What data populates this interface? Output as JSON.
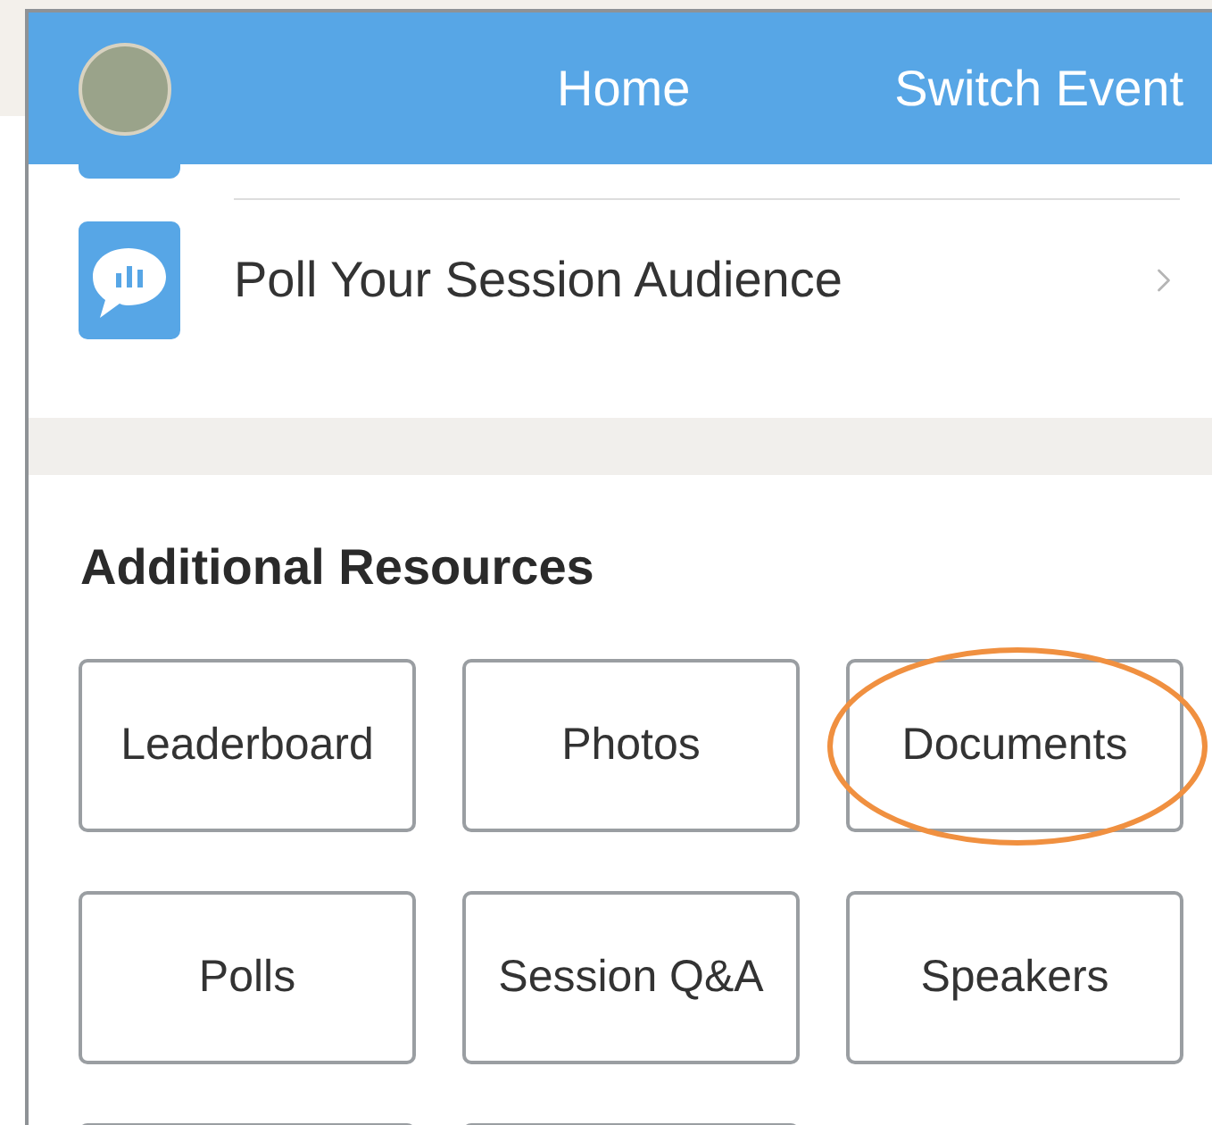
{
  "header": {
    "title": "Home",
    "action": "Switch Event"
  },
  "menu_row": {
    "label": "Poll Your Session Audience"
  },
  "section": {
    "title": "Additional Resources",
    "buttons": [
      {
        "label": "Leaderboard",
        "circled": false
      },
      {
        "label": "Photos",
        "circled": false
      },
      {
        "label": "Documents",
        "circled": true
      },
      {
        "label": "Polls",
        "circled": false
      },
      {
        "label": "Session Q&A",
        "circled": false
      },
      {
        "label": "Speakers",
        "circled": false
      }
    ]
  }
}
